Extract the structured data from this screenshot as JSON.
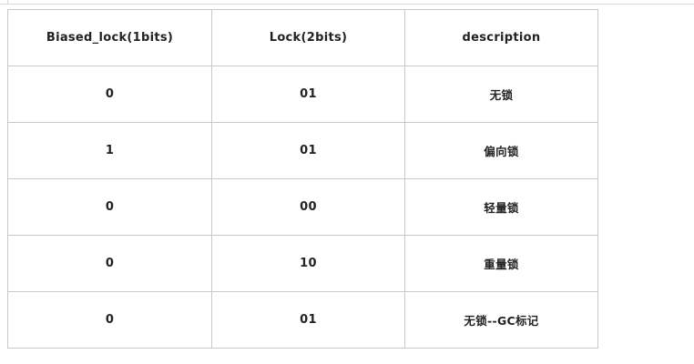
{
  "table": {
    "headers": [
      "Biased_lock(1bits)",
      "Lock(2bits)",
      "description"
    ],
    "rows": [
      [
        "0",
        "01",
        "无锁"
      ],
      [
        "1",
        "01",
        "偏向锁"
      ],
      [
        "0",
        "00",
        "轻量锁"
      ],
      [
        "0",
        "10",
        "重量锁"
      ],
      [
        "0",
        "01",
        "无锁--GC标记"
      ]
    ]
  }
}
